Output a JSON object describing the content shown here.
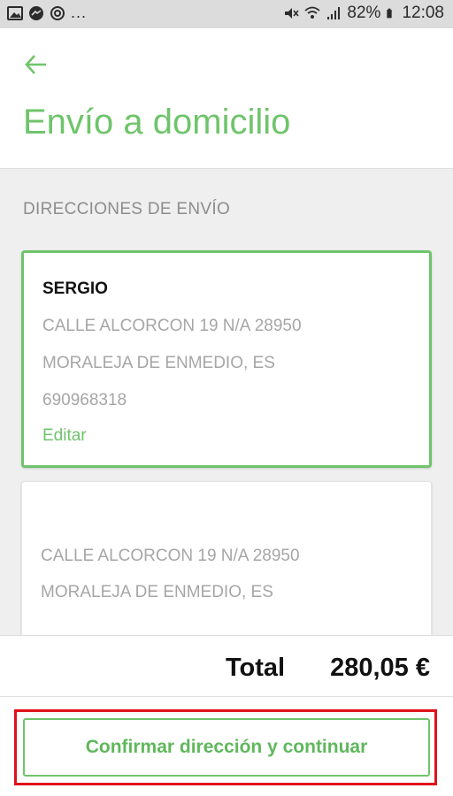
{
  "status_bar": {
    "battery": "82%",
    "time": "12:08",
    "overflow": "...",
    "icons_left": [
      "gallery-icon",
      "messenger-icon",
      "sync-icon"
    ],
    "icons_right": [
      "mute-icon",
      "wifi-icon",
      "signal-icon",
      "battery-icon"
    ]
  },
  "header": {
    "title": "Envío a domicilio",
    "back_icon": "arrow-left-icon"
  },
  "section": {
    "title": "DIRECCIONES DE ENVÍO"
  },
  "addresses": [
    {
      "name": "SERGIO",
      "street": "CALLE ALCORCON 19 N/A 28950",
      "city": "MORALEJA DE ENMEDIO, ES",
      "phone": "690968318",
      "edit_label": "Editar",
      "selected": true
    },
    {
      "name": "",
      "street": "CALLE ALCORCON 19 N/A 28950",
      "city": "MORALEJA DE ENMEDIO, ES",
      "selected": false
    }
  ],
  "summary": {
    "total_label": "Total",
    "total_value": "280,05 €"
  },
  "confirm_button": {
    "label": "Confirmar dirección y continuar"
  },
  "colors": {
    "accent": "#6fc46b",
    "highlight_box": "#e0121a"
  }
}
